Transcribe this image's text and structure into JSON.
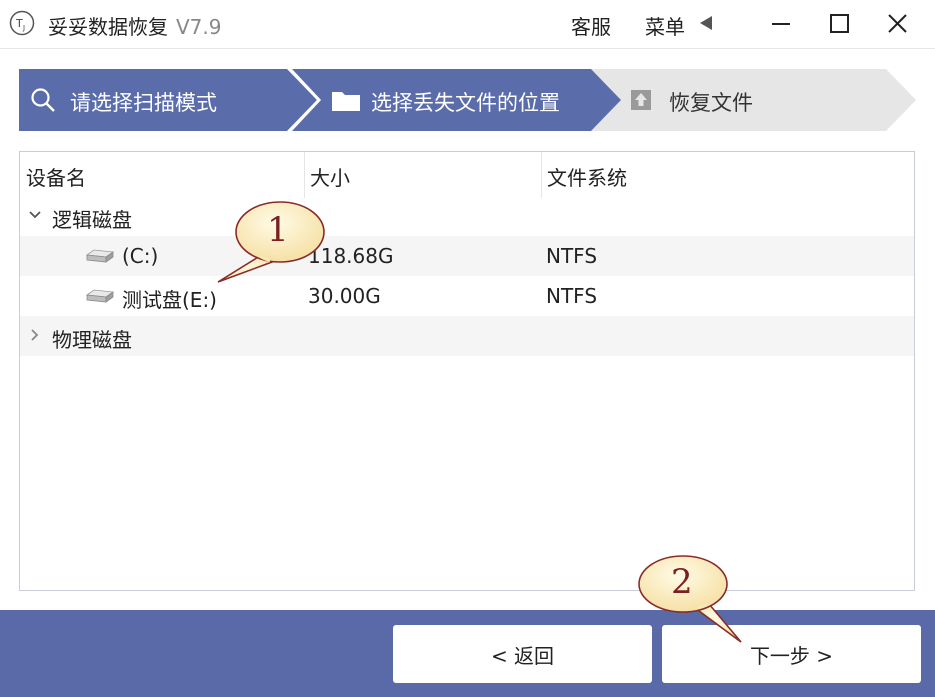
{
  "app": {
    "title": "妥妥数据恢复",
    "version": "V7.9",
    "icon_letters": "T",
    "menu_service": "客服",
    "menu_main": "菜单"
  },
  "window_controls": {
    "minimize_icon": "minimize-icon",
    "maximize_icon": "maximize-icon",
    "close_icon": "close-icon"
  },
  "steps": [
    {
      "label": "请选择扫描模式",
      "icon": "search-icon",
      "state": "done"
    },
    {
      "label": "选择丢失文件的位置",
      "icon": "folder-icon",
      "state": "active"
    },
    {
      "label": "恢复文件",
      "icon": "upload-icon",
      "state": "pending"
    }
  ],
  "table": {
    "headers": [
      "设备名",
      "大小",
      "文件系统"
    ],
    "groups": [
      {
        "label": "逻辑磁盘",
        "expanded": true,
        "rows": [
          {
            "name": "(C:)",
            "size": "118.68G",
            "fs": "NTFS"
          },
          {
            "name": "测试盘(E:)",
            "size": "30.00G",
            "fs": "NTFS"
          }
        ]
      },
      {
        "label": "物理磁盘",
        "expanded": false,
        "rows": []
      }
    ]
  },
  "buttons": {
    "back": "< 返回",
    "next": "下一步 >"
  },
  "callouts": [
    "1",
    "2"
  ],
  "colors": {
    "accent": "#5a6aa8",
    "step_active": "#5b6cab",
    "step_pending": "#e6e6e6"
  }
}
